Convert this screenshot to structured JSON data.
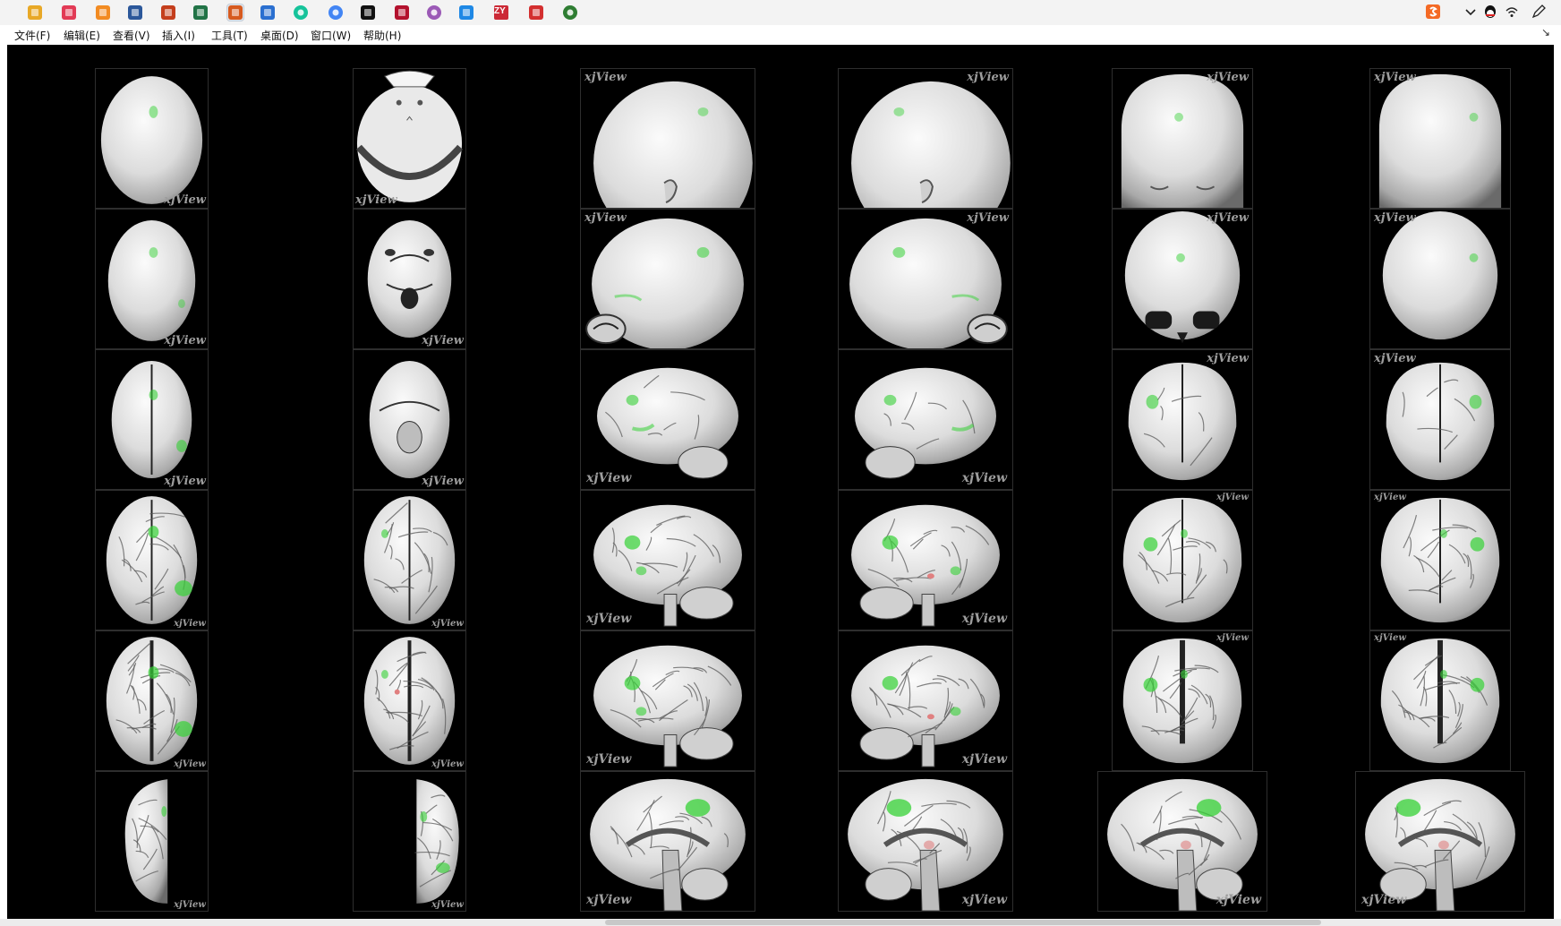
{
  "taskbar": {
    "icons": [
      {
        "name": "file-explorer-icon",
        "color": "#e8a826"
      },
      {
        "name": "app-red-grid-icon",
        "color": "#e23a55"
      },
      {
        "name": "app-orange-icon",
        "color": "#f28b22"
      },
      {
        "name": "word-icon",
        "color": "#2b579a"
      },
      {
        "name": "powerpoint-icon",
        "color": "#c43e1c"
      },
      {
        "name": "excel-icon",
        "color": "#217346"
      },
      {
        "name": "matlab-icon",
        "color": "#d65a1f"
      },
      {
        "name": "app-blue-icon",
        "color": "#2a6fd0"
      },
      {
        "name": "grammarly-icon",
        "color": "#15c39a"
      },
      {
        "name": "chrome-icon",
        "color": "#4285f4"
      },
      {
        "name": "qq-icon",
        "color": "#111111"
      },
      {
        "name": "mendeley-icon",
        "color": "#b3112d"
      },
      {
        "name": "app-colorful-icon",
        "color": "#9b59b6"
      },
      {
        "name": "app-blue-square-icon",
        "color": "#1e88e5"
      },
      {
        "name": "zotero-icon",
        "color": "#cc2936"
      },
      {
        "name": "app-red-book-icon",
        "color": "#d32f2f"
      },
      {
        "name": "app-green-icon",
        "color": "#2e7d32"
      }
    ],
    "zy_text": "ZY"
  },
  "menu": {
    "items": [
      "文件(F)",
      "编辑(E)",
      "查看(V)",
      "插入(I)",
      "工具(T)",
      "桌面(D)",
      "窗口(W)",
      "帮助(H)"
    ],
    "collapse_arrow": "↘"
  },
  "figure": {
    "watermark": "xjView",
    "columns": [
      "top",
      "bottom",
      "left",
      "right",
      "front",
      "back"
    ],
    "rows": [
      "scalp",
      "skull",
      "brain-outer",
      "cortex",
      "inflated-cortex",
      "medial-section"
    ],
    "activation_color": "#35d135",
    "red_activation_color": "#e08080"
  }
}
